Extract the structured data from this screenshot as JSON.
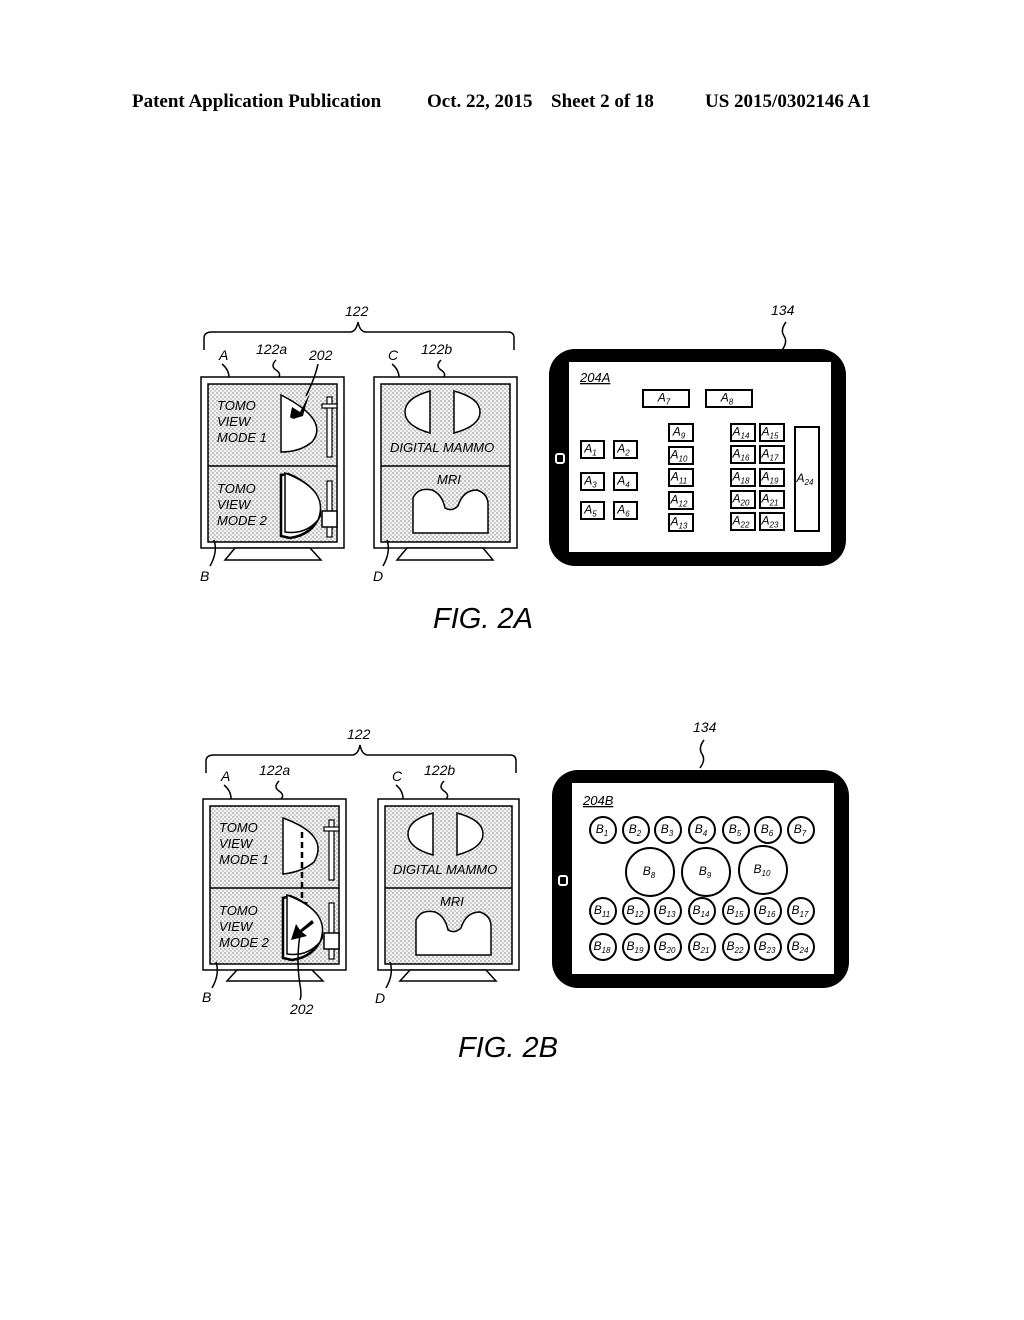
{
  "header": {
    "left": "Patent Application Publication",
    "date": "Oct. 22, 2015",
    "sheet": "Sheet 2 of 18",
    "number": "US 2015/0302146 A1"
  },
  "figures": [
    {
      "id": "fig2a",
      "caption": "FIG. 2A",
      "display_group_ref": "122",
      "monitor_left": {
        "ref": "122a",
        "pane_top_ref": "A",
        "pane_bottom_ref": "B",
        "top_text": [
          "TOMO",
          "VIEW",
          "MODE 1"
        ],
        "bottom_text": [
          "TOMO",
          "VIEW",
          "MODE 2"
        ],
        "pointer_ref": "202"
      },
      "monitor_right": {
        "ref": "122b",
        "pane_top_ref": "C",
        "pane_bottom_ref": "D",
        "top_text": "DIGITAL MAMMO",
        "bottom_text": "MRI"
      },
      "tablet": {
        "ref": "134",
        "layout_label": "204A",
        "buttons": [
          {
            "b": "A",
            "n": "1"
          },
          {
            "b": "A",
            "n": "2"
          },
          {
            "b": "A",
            "n": "3"
          },
          {
            "b": "A",
            "n": "4"
          },
          {
            "b": "A",
            "n": "5"
          },
          {
            "b": "A",
            "n": "6"
          },
          {
            "b": "A",
            "n": "7"
          },
          {
            "b": "A",
            "n": "8"
          },
          {
            "b": "A",
            "n": "9"
          },
          {
            "b": "A",
            "n": "10"
          },
          {
            "b": "A",
            "n": "11"
          },
          {
            "b": "A",
            "n": "12"
          },
          {
            "b": "A",
            "n": "13"
          },
          {
            "b": "A",
            "n": "14"
          },
          {
            "b": "A",
            "n": "15"
          },
          {
            "b": "A",
            "n": "16"
          },
          {
            "b": "A",
            "n": "17"
          },
          {
            "b": "A",
            "n": "18"
          },
          {
            "b": "A",
            "n": "19"
          },
          {
            "b": "A",
            "n": "20"
          },
          {
            "b": "A",
            "n": "21"
          },
          {
            "b": "A",
            "n": "22"
          },
          {
            "b": "A",
            "n": "23"
          },
          {
            "b": "A",
            "n": "24"
          }
        ]
      }
    },
    {
      "id": "fig2b",
      "caption": "FIG. 2B",
      "display_group_ref": "122",
      "monitor_left": {
        "ref": "122a",
        "pane_top_ref": "A",
        "pane_bottom_ref": "B",
        "top_text": [
          "TOMO",
          "VIEW",
          "MODE 1"
        ],
        "bottom_text": [
          "TOMO",
          "VIEW",
          "MODE 2"
        ],
        "pointer_ref": "202"
      },
      "monitor_right": {
        "ref": "122b",
        "pane_top_ref": "C",
        "pane_bottom_ref": "D",
        "top_text": "DIGITAL MAMMO",
        "bottom_text": "MRI"
      },
      "tablet": {
        "ref": "134",
        "layout_label": "204B",
        "buttons": [
          {
            "b": "B",
            "n": "1"
          },
          {
            "b": "B",
            "n": "2"
          },
          {
            "b": "B",
            "n": "3"
          },
          {
            "b": "B",
            "n": "4"
          },
          {
            "b": "B",
            "n": "5"
          },
          {
            "b": "B",
            "n": "6"
          },
          {
            "b": "B",
            "n": "7"
          },
          {
            "b": "B",
            "n": "8"
          },
          {
            "b": "B",
            "n": "9"
          },
          {
            "b": "B",
            "n": "10"
          },
          {
            "b": "B",
            "n": "11"
          },
          {
            "b": "B",
            "n": "12"
          },
          {
            "b": "B",
            "n": "13"
          },
          {
            "b": "B",
            "n": "14"
          },
          {
            "b": "B",
            "n": "15"
          },
          {
            "b": "B",
            "n": "16"
          },
          {
            "b": "B",
            "n": "17"
          },
          {
            "b": "B",
            "n": "18"
          },
          {
            "b": "B",
            "n": "19"
          },
          {
            "b": "B",
            "n": "20"
          },
          {
            "b": "B",
            "n": "21"
          },
          {
            "b": "B",
            "n": "22"
          },
          {
            "b": "B",
            "n": "23"
          },
          {
            "b": "B",
            "n": "24"
          }
        ]
      }
    }
  ]
}
